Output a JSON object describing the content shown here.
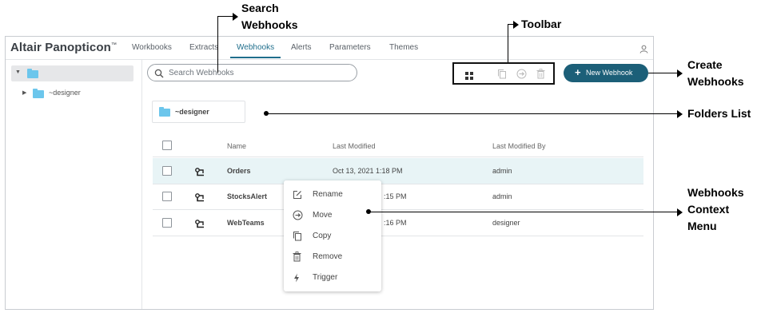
{
  "brand": "Altair Panopticon",
  "brand_mark": "™",
  "nav_tabs": [
    "Workbooks",
    "Extracts",
    "Webhooks",
    "Alerts",
    "Parameters",
    "Themes"
  ],
  "active_tab": "Webhooks",
  "sidebar": {
    "child_folder": "~designer"
  },
  "search": {
    "placeholder": "Search Webhooks"
  },
  "new_webhook_label": "New Webhook",
  "folder_card": "~designer",
  "table": {
    "headers": [
      "Name",
      "Last Modified",
      "Last Modified By"
    ],
    "rows": [
      {
        "name": "Orders",
        "modified": "Oct 13, 2021 1:18 PM",
        "by": "admin"
      },
      {
        "name": "StocksAlert",
        "modified": ":15 PM",
        "by": "admin"
      },
      {
        "name": "WebTeams",
        "modified": ":16 PM",
        "by": "designer"
      }
    ]
  },
  "context_menu": [
    "Rename",
    "Move",
    "Copy",
    "Remove",
    "Trigger"
  ],
  "annotations": {
    "search": "Search Webhooks",
    "toolbar": "Toolbar",
    "create": "Create Webhooks",
    "folders": "Folders List",
    "context": "Webhooks Context Menu"
  },
  "colors": {
    "accent": "#1c5f78",
    "folder": "#6cc6ec",
    "row_highlight": "#e8f4f6"
  }
}
